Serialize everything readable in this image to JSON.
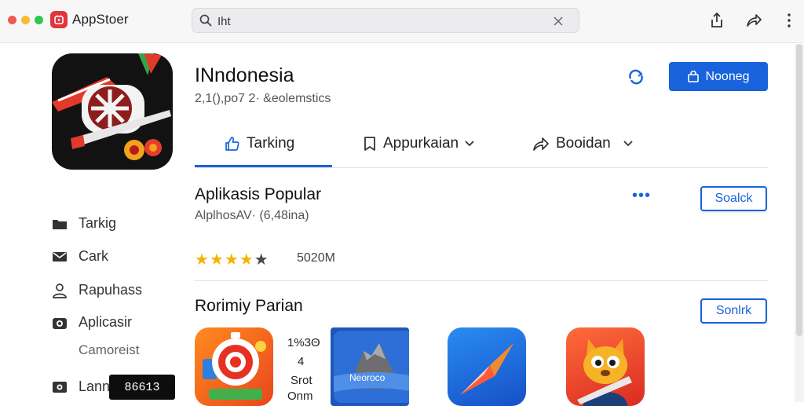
{
  "window": {
    "title": "AppStoer",
    "traffic_lights": [
      "#ee5a52",
      "#f5bd2f",
      "#2fc84a"
    ]
  },
  "search": {
    "value": "Iht"
  },
  "app": {
    "title": "INndonesia",
    "subtitle": "2,1(),po7 2· &eolemstics",
    "install_label": "Nooneg"
  },
  "tabs": [
    {
      "label": "Tarking",
      "icon": "thumbs-up-icon",
      "active": true
    },
    {
      "label": "Appurkaian",
      "icon": "bookmark-icon",
      "dropdown": true
    },
    {
      "label": "Booidan",
      "icon": "share-icon",
      "dropdown": true
    }
  ],
  "sections": {
    "popular": {
      "title": "Aplikasis Popular",
      "subtitle": "AlplhosAV· (6,48ina)",
      "button_label": "Soalck",
      "rating": 4,
      "rating_count": "5020M"
    },
    "rom": {
      "title": "Rorimiy Parian",
      "button_label": "Sonlrk"
    }
  },
  "sidebar": {
    "items": [
      {
        "label": "Tarkig",
        "icon": "folder-icon"
      },
      {
        "label": "Cark",
        "icon": "mail-icon"
      },
      {
        "label": "Rapuhass",
        "icon": "user-icon"
      },
      {
        "label": "Aplicasir",
        "icon": "camera-icon"
      },
      {
        "label": "Lann",
        "icon": "photo-icon"
      }
    ],
    "sub_label": "Camoreist",
    "badge_text": "86613"
  },
  "tiles": {
    "info": [
      "1%3Θ",
      "4",
      "Srot",
      "Onm"
    ],
    "third_tile_label": "Neoroco"
  },
  "colors": {
    "accent": "#1863dc",
    "star": "#f4b400"
  }
}
